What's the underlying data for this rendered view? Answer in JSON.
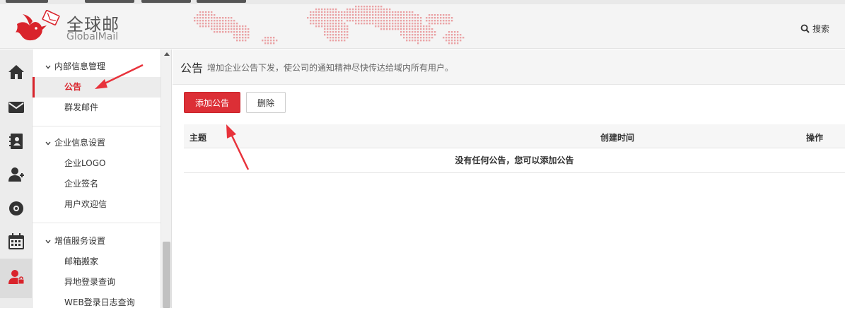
{
  "header": {
    "brand_cn": "全球邮",
    "brand_en": "GlobalMail",
    "search_label": "搜索"
  },
  "iconbar": {
    "icons": [
      "home-icon",
      "mail-icon",
      "contacts-icon",
      "add-user-icon",
      "disc-icon",
      "calendar-icon",
      "admin-user-icon"
    ]
  },
  "sidebar": {
    "groups": [
      {
        "title": "内部信息管理",
        "items": [
          "公告",
          "群发邮件"
        ]
      },
      {
        "title": "企业信息设置",
        "items": [
          "企业LOGO",
          "企业签名",
          "用户欢迎信"
        ]
      },
      {
        "title": "增值服务设置",
        "items": [
          "邮箱搬家",
          "异地登录查询",
          "WEB登录日志查询"
        ]
      }
    ],
    "active_item": "公告"
  },
  "page": {
    "title": "公告",
    "description": "增加企业公告下发，使公司的通知精神尽快传达给域内所有用户。"
  },
  "toolbar": {
    "add_label": "添加公告",
    "delete_label": "删除"
  },
  "table": {
    "columns": [
      "主题",
      "创建时间",
      "操作"
    ],
    "empty_message": "没有任何公告，您可以添加公告"
  },
  "colors": {
    "accent": "#dc2f36",
    "annotation_arrow": "#e8323b"
  }
}
